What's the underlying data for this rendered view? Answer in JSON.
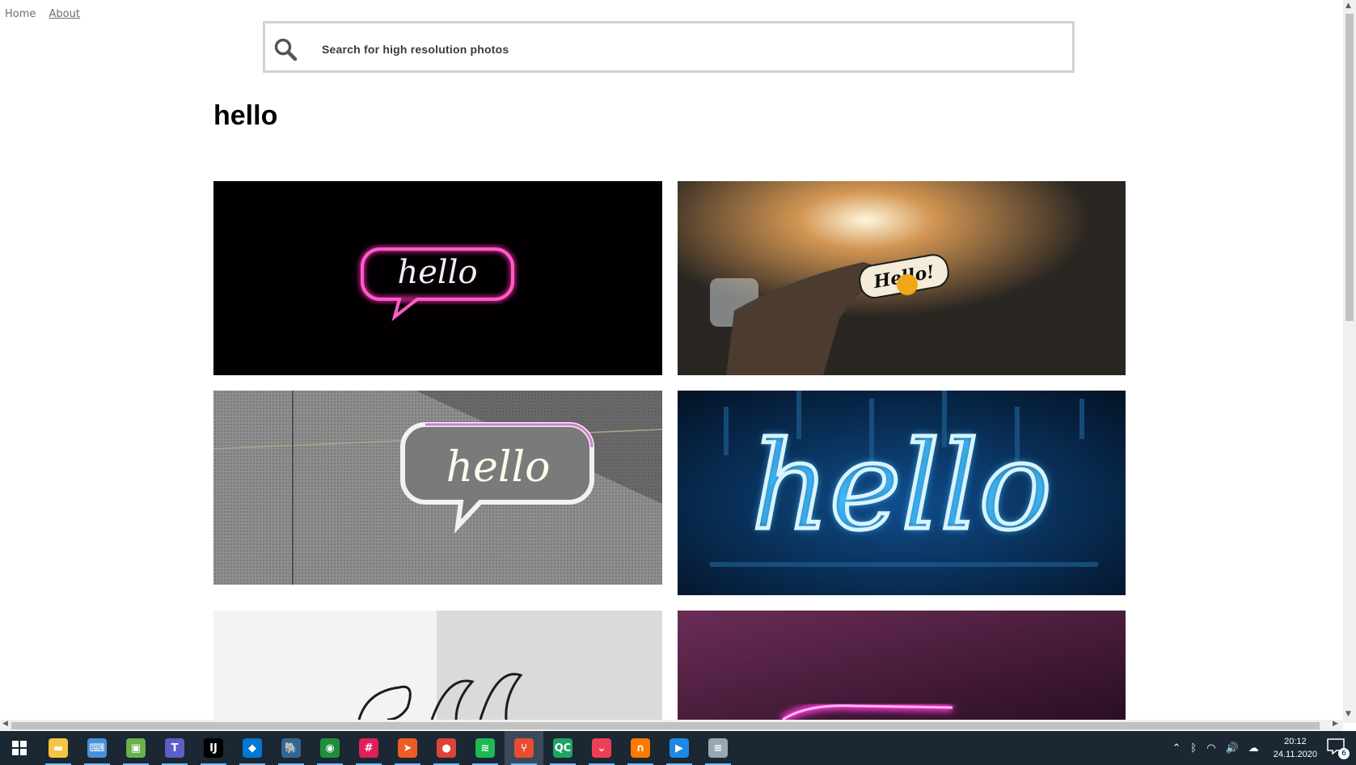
{
  "nav": {
    "home": "Home",
    "about": "About"
  },
  "search": {
    "placeholder": "Search for high resolution photos"
  },
  "query_title": "hello",
  "photos": [
    {
      "alt": "pink neon hello speech bubble on black",
      "sign_text": "hello"
    },
    {
      "alt": "hand holding Hello! sticker with smiley",
      "sign_text": "Hello!"
    },
    {
      "alt": "white neon hello speech bubble on grey wall",
      "sign_text": "hello"
    },
    {
      "alt": "blue neon hello sign",
      "sign_text": "hello"
    },
    {
      "alt": "handwritten hello on white",
      "sign_text": "hello"
    },
    {
      "alt": "pink neon sign on purple wall",
      "sign_text": ""
    }
  ],
  "taskbar": {
    "apps": [
      {
        "icon": "file-explorer-icon",
        "glyph": "▬",
        "color": "#f4c542"
      },
      {
        "icon": "remote-desktop-icon",
        "glyph": "⌨",
        "color": "#4a90d9"
      },
      {
        "icon": "virtual-machine-icon",
        "glyph": "▣",
        "color": "#6ab04c"
      },
      {
        "icon": "teams-icon",
        "glyph": "T",
        "color": "#5b5fc7"
      },
      {
        "icon": "intellij-icon",
        "glyph": "IJ",
        "color": "#000000"
      },
      {
        "icon": "vscode-icon",
        "glyph": "◆",
        "color": "#0078d4"
      },
      {
        "icon": "postgres-icon",
        "glyph": "🐘",
        "color": "#336791"
      },
      {
        "icon": "maps-icon",
        "glyph": "◉",
        "color": "#1e8e3e"
      },
      {
        "icon": "slack-icon",
        "glyph": "#",
        "color": "#e01e5a"
      },
      {
        "icon": "postman-icon",
        "glyph": "➤",
        "color": "#ef5b25"
      },
      {
        "icon": "chrome-icon",
        "glyph": "●",
        "color": "#db4437"
      },
      {
        "icon": "spotify-icon",
        "glyph": "≋",
        "color": "#1db954"
      },
      {
        "icon": "git-icon",
        "glyph": "⑂",
        "color": "#e84d31"
      },
      {
        "icon": "qc-icon",
        "glyph": "QC",
        "color": "#21a366"
      },
      {
        "icon": "pocket-icon",
        "glyph": "⌄",
        "color": "#ef3f56"
      },
      {
        "icon": "headset-icon",
        "glyph": "∩",
        "color": "#ff7a00"
      },
      {
        "icon": "video-player-icon",
        "glyph": "▶",
        "color": "#1e88e5"
      },
      {
        "icon": "notepad-icon",
        "glyph": "≡",
        "color": "#9aa7b3"
      }
    ],
    "active_index": 12,
    "clock_time": "20:12",
    "clock_date": "24.11.2020",
    "notification_count": "6"
  }
}
